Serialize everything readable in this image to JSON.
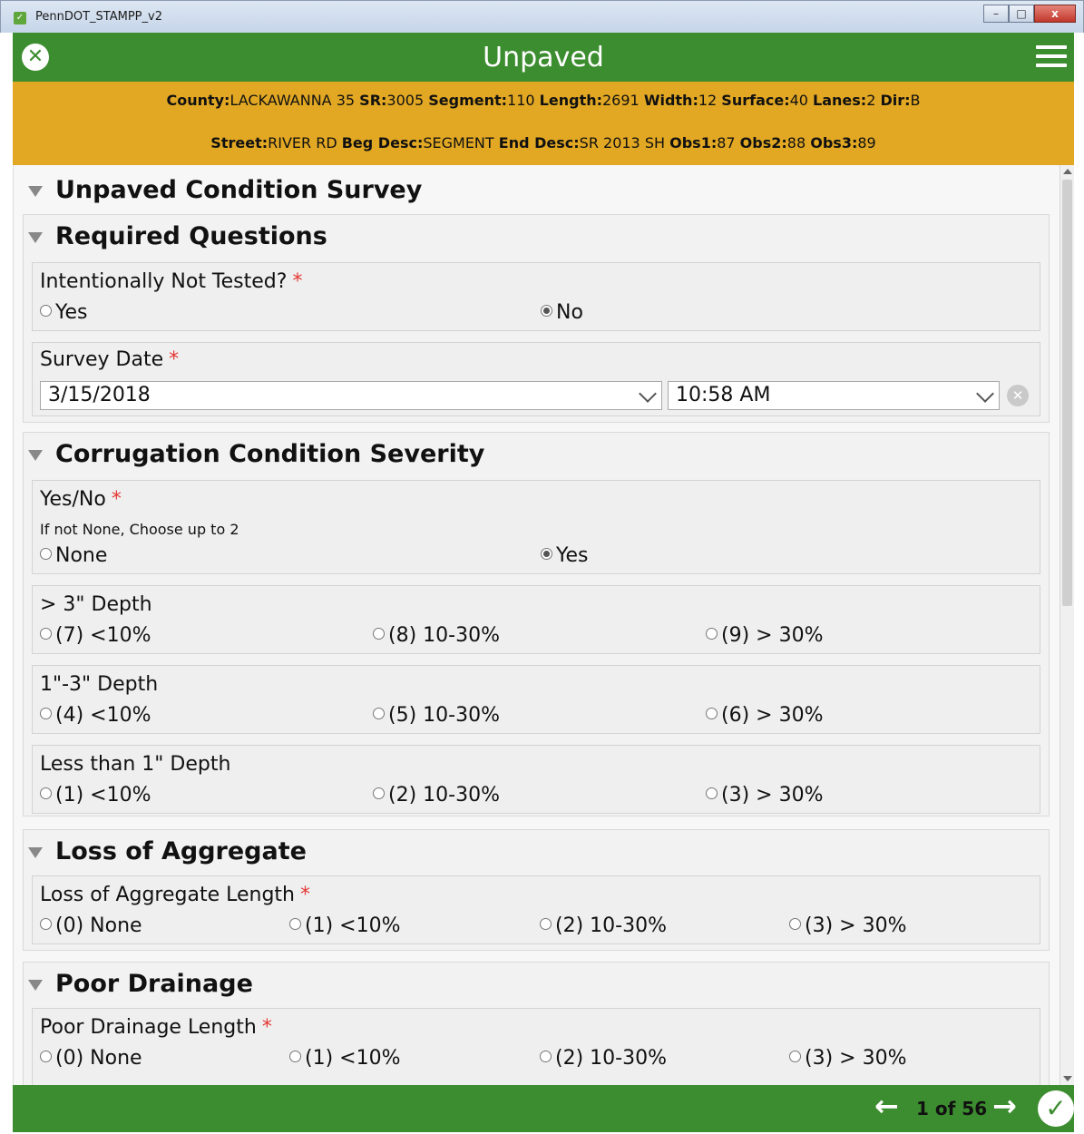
{
  "window": {
    "title": "PennDOT_STAMPP_v2",
    "minimize": "–",
    "maximize": "□",
    "close": "x"
  },
  "header": {
    "title": "Unpaved"
  },
  "info": {
    "line1": [
      {
        "k": "County:",
        "v": "LACKAWANNA 35"
      },
      {
        "k": "SR:",
        "v": "3005"
      },
      {
        "k": "Segment:",
        "v": "110"
      },
      {
        "k": "Length:",
        "v": "2691"
      },
      {
        "k": "Width:",
        "v": "12"
      },
      {
        "k": "Surface:",
        "v": "40"
      },
      {
        "k": "Lanes:",
        "v": "2"
      },
      {
        "k": "Dir:",
        "v": "B"
      }
    ],
    "line2": [
      {
        "k": "Street:",
        "v": "RIVER RD"
      },
      {
        "k": "Beg Desc:",
        "v": "SEGMENT"
      },
      {
        "k": "End Desc:",
        "v": "SR 2013 SH"
      },
      {
        "k": "Obs1:",
        "v": "87"
      },
      {
        "k": "Obs2:",
        "v": "88"
      },
      {
        "k": "Obs3:",
        "v": "89"
      }
    ]
  },
  "survey": {
    "title": "Unpaved Condition Survey",
    "required": {
      "title": "Required Questions",
      "not_tested": {
        "label": "Intentionally Not Tested?",
        "req": "*",
        "opt_yes": "Yes",
        "opt_no": "No",
        "selected": "No"
      },
      "survey_date": {
        "label": "Survey Date",
        "req": "*",
        "date": "3/15/2018",
        "time": "10:58 AM"
      }
    },
    "corrugation": {
      "title": "Corrugation Condition Severity",
      "yesno": {
        "label": "Yes/No",
        "req": "*",
        "hint": "If not None, Choose up to 2",
        "opt_none": "None",
        "opt_yes": "Yes",
        "selected": "Yes"
      },
      "depth3": {
        "label": "> 3\" Depth",
        "o1": "(7) <10%",
        "o2": "(8) 10-30%",
        "o3": "(9) > 30%"
      },
      "depth13": {
        "label": "1\"-3\" Depth",
        "o1": "(4) <10%",
        "o2": "(5) 10-30%",
        "o3": "(6) > 30%"
      },
      "depth1": {
        "label": "Less than 1\" Depth",
        "o1": "(1) <10%",
        "o2": "(2) 10-30%",
        "o3": "(3) > 30%"
      }
    },
    "aggregate": {
      "title": "Loss of Aggregate",
      "length": {
        "label": "Loss of Aggregate Length",
        "req": "*",
        "o0": "(0) None",
        "o1": "(1) <10%",
        "o2": "(2) 10-30%",
        "o3": "(3) > 30%"
      }
    },
    "drainage": {
      "title": "Poor Drainage",
      "length": {
        "label": "Poor Drainage Length",
        "req": "*",
        "o0": "(0) None",
        "o1": "(1) <10%",
        "o2": "(2) 10-30%",
        "o3": "(3) > 30%"
      }
    }
  },
  "footer": {
    "page": "1 of 56",
    "prev": "←",
    "next": "→",
    "done": "✓"
  }
}
